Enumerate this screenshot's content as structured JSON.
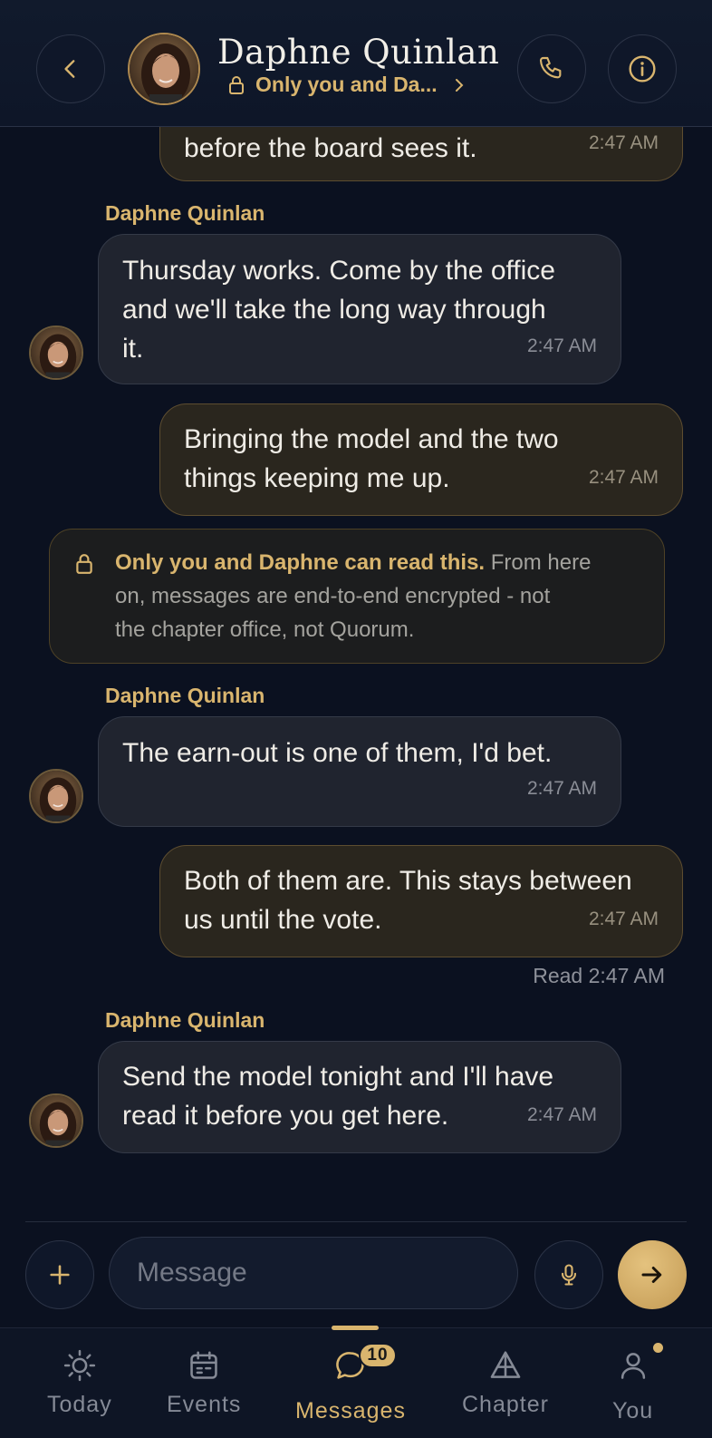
{
  "header": {
    "contact_name": "Daphne Quinlan",
    "encryption_status": "Only you and Da...",
    "back_icon": "chevron-left-icon",
    "call_icon": "phone-icon",
    "info_icon": "info-icon"
  },
  "messages": [
    {
      "direction": "out",
      "text": "before the board sees it.",
      "time": "2:47 AM"
    },
    {
      "direction": "in",
      "sender": "Daphne Quinlan",
      "lines": [
        "Thursday works. Come by the office",
        "and we'll take the long way through",
        "it."
      ],
      "time": "2:47 AM"
    },
    {
      "direction": "out",
      "lines": [
        "Bringing the model and the two",
        "things keeping me up."
      ],
      "time": "2:47 AM"
    },
    {
      "direction": "in",
      "sender": "Daphne Quinlan",
      "text": "The earn-out is one of them, I'd bet.",
      "time": "2:47 AM"
    },
    {
      "direction": "out",
      "lines": [
        "Both of them are. This stays between",
        "us until the vote."
      ],
      "time": "2:47 AM"
    },
    {
      "direction": "in",
      "sender": "Daphne Quinlan",
      "lines": [
        "Send the model tonight and I'll have",
        "read it before you get here."
      ],
      "time": "2:47 AM"
    }
  ],
  "encryption_notice": {
    "bold": "Only you and Daphne can read this.",
    "lines": [
      " From here",
      "on, messages are end-to-end encrypted - not",
      "the chapter office, not Quorum."
    ]
  },
  "read_receipt": "Read 2:47 AM",
  "composer": {
    "placeholder": "Message",
    "add_icon": "plus-icon",
    "mic_icon": "microphone-icon",
    "send_icon": "arrow-right-icon"
  },
  "tabs": [
    {
      "label": "Today",
      "icon": "sun-icon"
    },
    {
      "label": "Events",
      "icon": "calendar-icon"
    },
    {
      "label": "Messages",
      "icon": "chat-bubble-icon",
      "badge": "10",
      "active": true
    },
    {
      "label": "Chapter",
      "icon": "pyramid-icon"
    },
    {
      "label": "You",
      "icon": "person-icon",
      "dot": true
    }
  ],
  "colors": {
    "accent": "#d9b56e",
    "background": "#0b1120",
    "incoming_bubble": "#20242f",
    "outgoing_bubble": "#2a261e"
  }
}
